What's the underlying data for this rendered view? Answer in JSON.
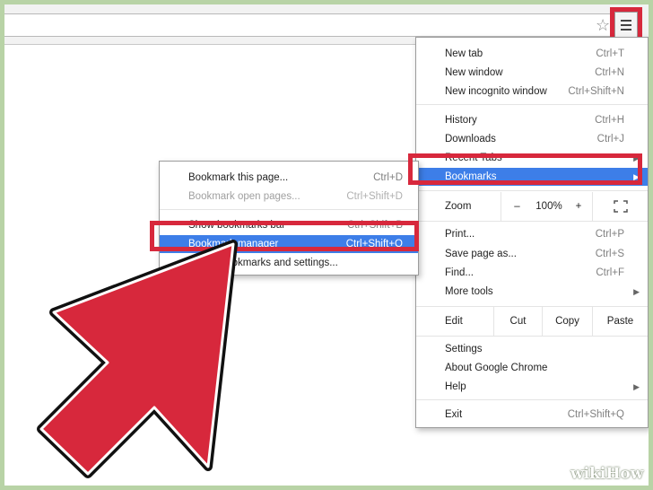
{
  "menu": {
    "groups": [
      [
        {
          "label": "New tab",
          "shortcut": "Ctrl+T"
        },
        {
          "label": "New window",
          "shortcut": "Ctrl+N"
        },
        {
          "label": "New incognito window",
          "shortcut": "Ctrl+Shift+N"
        }
      ],
      [
        {
          "label": "History",
          "shortcut": "Ctrl+H"
        },
        {
          "label": "Downloads",
          "shortcut": "Ctrl+J"
        },
        {
          "label": "Recent Tabs",
          "shortcut": ""
        },
        {
          "label": "Bookmarks",
          "shortcut": ""
        }
      ]
    ],
    "zoom": {
      "label": "Zoom",
      "minus": "–",
      "value": "100%",
      "plus": "+"
    },
    "group3": [
      {
        "label": "Print...",
        "shortcut": "Ctrl+P"
      },
      {
        "label": "Save page as...",
        "shortcut": "Ctrl+S"
      },
      {
        "label": "Find...",
        "shortcut": "Ctrl+F"
      },
      {
        "label": "More tools",
        "shortcut": ""
      }
    ],
    "edit": {
      "label": "Edit",
      "cut": "Cut",
      "copy": "Copy",
      "paste": "Paste"
    },
    "group4": [
      {
        "label": "Settings"
      },
      {
        "label": "About Google Chrome"
      },
      {
        "label": "Help"
      }
    ],
    "exit": {
      "label": "Exit",
      "shortcut": "Ctrl+Shift+Q"
    }
  },
  "submenu": {
    "items": [
      {
        "label": "Bookmark this page...",
        "shortcut": "Ctrl+D"
      },
      {
        "label": "Bookmark open pages...",
        "shortcut": "Ctrl+Shift+D"
      },
      {
        "label": "Show bookmarks bar",
        "shortcut": "Ctrl+Shift+B"
      },
      {
        "label": "Bookmark manager",
        "shortcut": "Ctrl+Shift+O"
      },
      {
        "label": "Import bookmarks and settings...",
        "shortcut": ""
      }
    ]
  },
  "watermark": "wikiHow",
  "colors": {
    "highlight": "#3d7ee8",
    "annotation_red": "#d7283c",
    "background": "#b8d3a6"
  }
}
